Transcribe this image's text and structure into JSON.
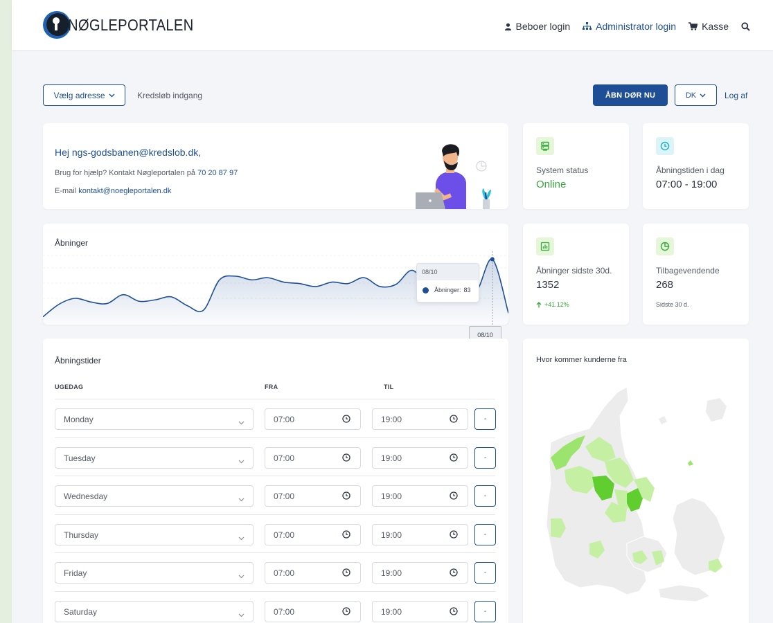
{
  "header": {
    "logo_text": "NØGLEPORTALEN",
    "nav": [
      {
        "label": "Beboer login",
        "icon": "user-icon"
      },
      {
        "label": "Administrator login",
        "icon": "sitemap-icon"
      },
      {
        "label": "Kasse",
        "icon": "cart-icon"
      }
    ],
    "search_icon": "search-icon"
  },
  "toolbar": {
    "address_select": "Vælg adresse",
    "location": "Kredsløb indgang",
    "open_door": "ÅBN DØR NU",
    "language": "DK",
    "logout": "Log af"
  },
  "welcome": {
    "greeting": "Hej ngs-godsbanen@kredslob.dk,",
    "help_text": "Brug for hjælp? Kontakt Nøgleportalen på",
    "phone": "70 20 87 97",
    "email_label": "E-mail",
    "email": "kontakt@noegleportalen.dk"
  },
  "stats": {
    "system_status": {
      "label": "System status",
      "value": "Online"
    },
    "opening_today": {
      "label": "Åbningstiden i dag",
      "value": "07:00 - 19:00"
    },
    "openings_30d": {
      "label": "Åbninger sidste 30d.",
      "value": "1352",
      "change": "+41.12%"
    },
    "returning": {
      "label": "Tilbagevendende",
      "value": "268",
      "sub": "Sidste 30 d."
    }
  },
  "chart": {
    "title": "Åbninger",
    "tooltip_date": "08/10",
    "tooltip_series": "Åbninger",
    "tooltip_value": "83",
    "x_marker": "08/10"
  },
  "chart_data": {
    "type": "area",
    "series": [
      {
        "name": "Åbninger",
        "values": [
          5,
          22,
          30,
          25,
          23,
          35,
          26,
          28,
          32,
          20,
          14,
          55,
          60,
          55,
          58,
          52,
          50,
          46,
          52,
          50,
          58,
          46,
          49,
          68,
          46,
          35,
          55,
          40,
          83,
          10
        ]
      }
    ],
    "highlight_label": "08/10",
    "highlight_value": 83,
    "ylim": [
      0,
      90
    ],
    "grid": true,
    "color": "#1e4f96"
  },
  "schedule": {
    "title": "Åbningstider",
    "col_day": "UGEDAG",
    "col_from": "FRA",
    "col_to": "TIL",
    "remove_label": "-",
    "rows": [
      {
        "day": "Monday",
        "from": "07:00",
        "to": "19:00"
      },
      {
        "day": "Tuesday",
        "from": "07:00",
        "to": "19:00"
      },
      {
        "day": "Wednesday",
        "from": "07:00",
        "to": "19:00"
      },
      {
        "day": "Thursday",
        "from": "07:00",
        "to": "19:00"
      },
      {
        "day": "Friday",
        "from": "07:00",
        "to": "19:00"
      },
      {
        "day": "Saturday",
        "from": "07:00",
        "to": "19:00"
      }
    ]
  },
  "map": {
    "title": "Hvor kommer kunderne fra",
    "colors": {
      "none": "#ececec",
      "low": "#c5f0a4",
      "mid": "#9be56e",
      "high": "#5fce2e"
    }
  },
  "colors": {
    "brand": "#1e4f96",
    "accent_green": "#35a93c",
    "background": "#f4f5f8"
  }
}
